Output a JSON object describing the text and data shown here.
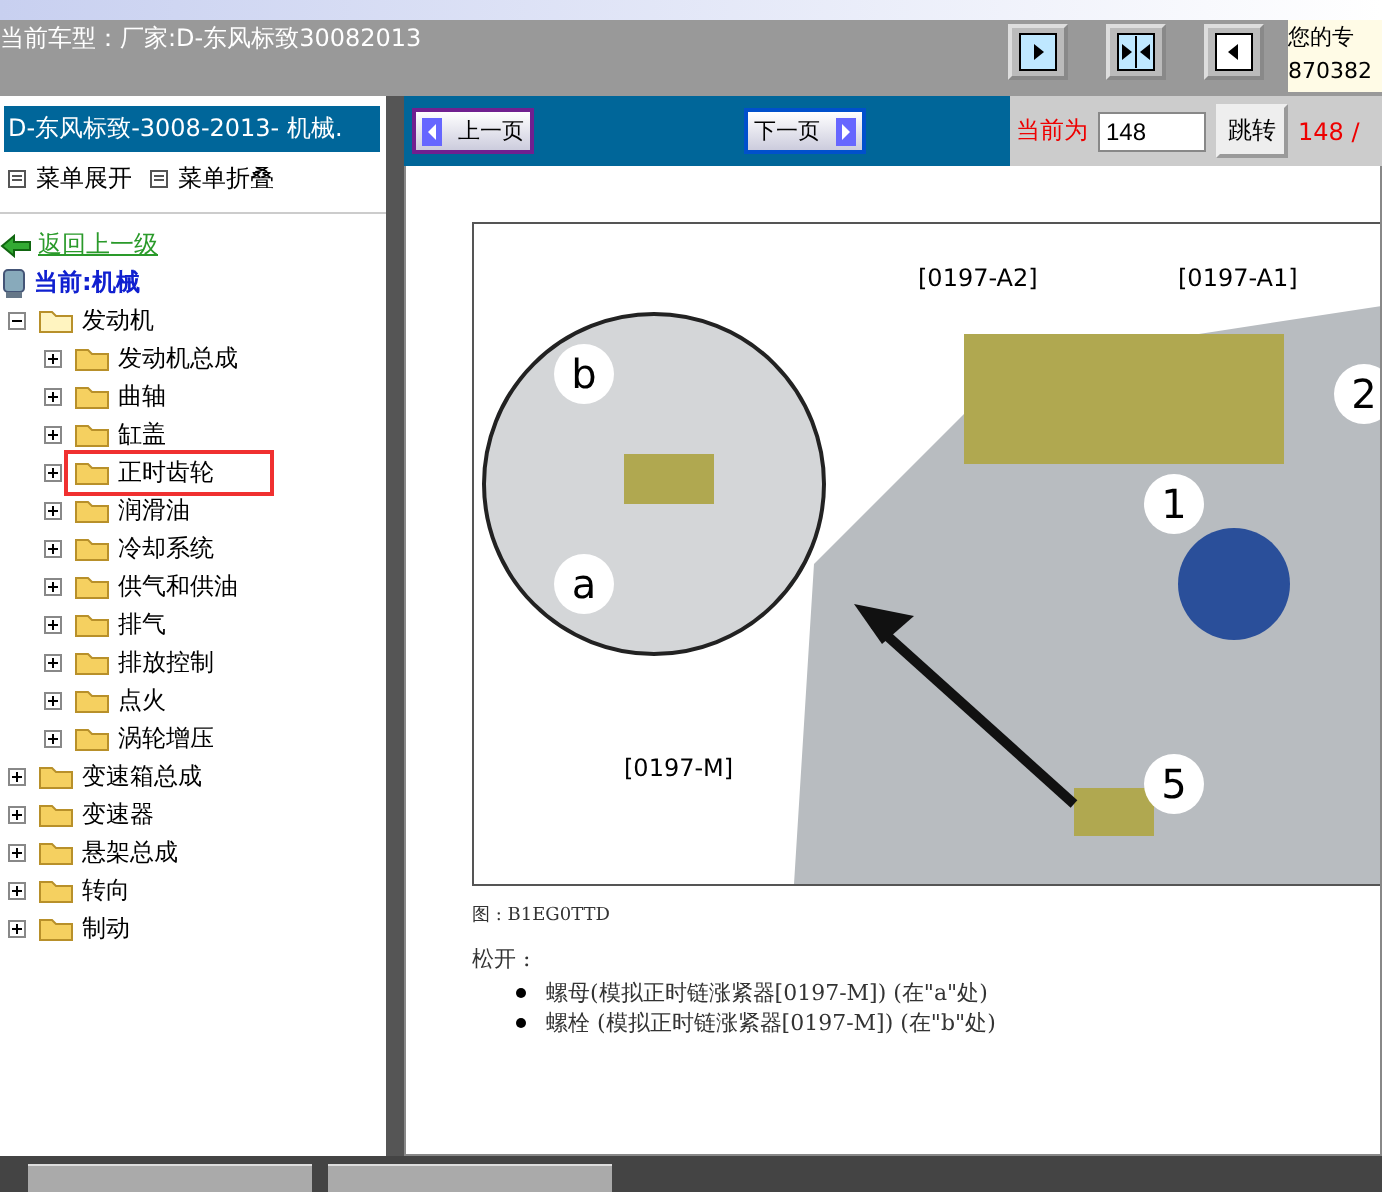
{
  "header": {
    "vehicle": "当前车型：厂家:D-东风标致30082013",
    "notice": [
      "您的专",
      "870382"
    ]
  },
  "sidebar": {
    "title": "D-东风标致-3008-2013- 机械.",
    "menu": [
      "菜单展开",
      "菜单折叠"
    ],
    "back_link": "返回上一级",
    "current": "当前:机械",
    "tree": [
      {
        "label": "发动机",
        "expanded": true,
        "highlighted": false,
        "children": [
          {
            "label": "发动机总成",
            "expanded": false,
            "highlighted": false
          },
          {
            "label": "曲轴",
            "expanded": false,
            "highlighted": false
          },
          {
            "label": "缸盖",
            "expanded": false,
            "highlighted": false
          },
          {
            "label": "正时齿轮",
            "expanded": false,
            "highlighted": true
          },
          {
            "label": "润滑油",
            "expanded": false,
            "highlighted": false
          },
          {
            "label": "冷却系统",
            "expanded": false,
            "highlighted": false
          },
          {
            "label": "供气和供油",
            "expanded": false,
            "highlighted": false
          },
          {
            "label": "排气",
            "expanded": false,
            "highlighted": false
          },
          {
            "label": "排放控制",
            "expanded": false,
            "highlighted": false
          },
          {
            "label": "点火",
            "expanded": false,
            "highlighted": false
          },
          {
            "label": "涡轮增压",
            "expanded": false,
            "highlighted": false
          }
        ]
      },
      {
        "label": "变速箱总成",
        "expanded": false,
        "highlighted": false
      },
      {
        "label": "变速器",
        "expanded": false,
        "highlighted": false
      },
      {
        "label": "悬架总成",
        "expanded": false,
        "highlighted": false
      },
      {
        "label": "转向",
        "expanded": false,
        "highlighted": false
      },
      {
        "label": "制动",
        "expanded": false,
        "highlighted": false
      }
    ]
  },
  "pager": {
    "prev": "上一页",
    "next": "下一页",
    "current_label": "当前为",
    "page": "148",
    "jump": "跳转",
    "total": "148 /"
  },
  "figure": {
    "callouts": [
      {
        "kind": "tag",
        "text": "[0197-A2]"
      },
      {
        "kind": "tag",
        "text": "[0197-A1]"
      },
      {
        "kind": "circle",
        "text": "b"
      },
      {
        "kind": "circle",
        "text": "a"
      },
      {
        "kind": "circle",
        "text": "1"
      },
      {
        "kind": "circle",
        "text": "2"
      },
      {
        "kind": "circle",
        "text": "5"
      },
      {
        "kind": "tag",
        "text": "[0197-M]"
      }
    ],
    "caption": "图 : B1EG0TTD"
  },
  "instructions": {
    "intro": "松开 :",
    "items": [
      "螺母(模拟正时链涨紧器[0197-M]) (在\"a\"处)",
      "螺栓  (模拟正时链涨紧器[0197-M]) (在\"b\"处)"
    ]
  }
}
